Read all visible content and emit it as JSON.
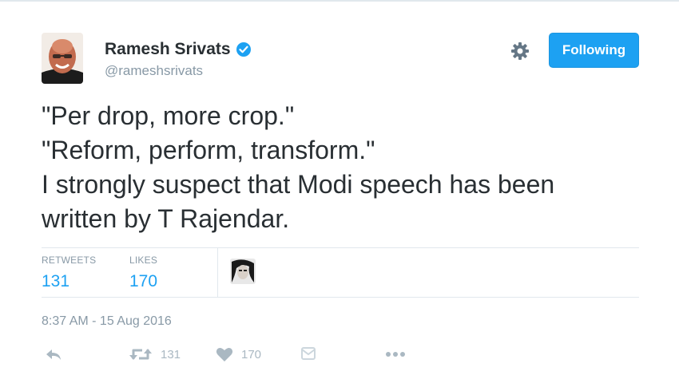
{
  "author": {
    "name": "Ramesh Srivats",
    "handle": "@rameshsrivats",
    "verified": true
  },
  "follow_button": {
    "label": "Following"
  },
  "tweet": {
    "lines": [
      "\"Per drop, more crop.\"",
      "\"Reform, perform, transform.\"",
      "I strongly suspect that Modi speech has been",
      "written by T Rajendar."
    ]
  },
  "stats": {
    "retweets": {
      "label": "RETWEETS",
      "value": "131"
    },
    "likes": {
      "label": "LIKES",
      "value": "170"
    }
  },
  "timestamp": "8:37 AM - 15 Aug 2016",
  "actions": {
    "reply_icon": "reply-icon",
    "retweet": {
      "icon": "retweet-icon",
      "count": "131"
    },
    "like": {
      "icon": "heart-icon",
      "count": "170"
    },
    "dm_icon": "direct-message-icon",
    "more_icon": "more-icon"
  },
  "colors": {
    "accent": "#1da1f2",
    "text": "#292f33",
    "muted": "#8899a6",
    "icon": "#aab8c2",
    "divider": "#e1e8ed"
  }
}
